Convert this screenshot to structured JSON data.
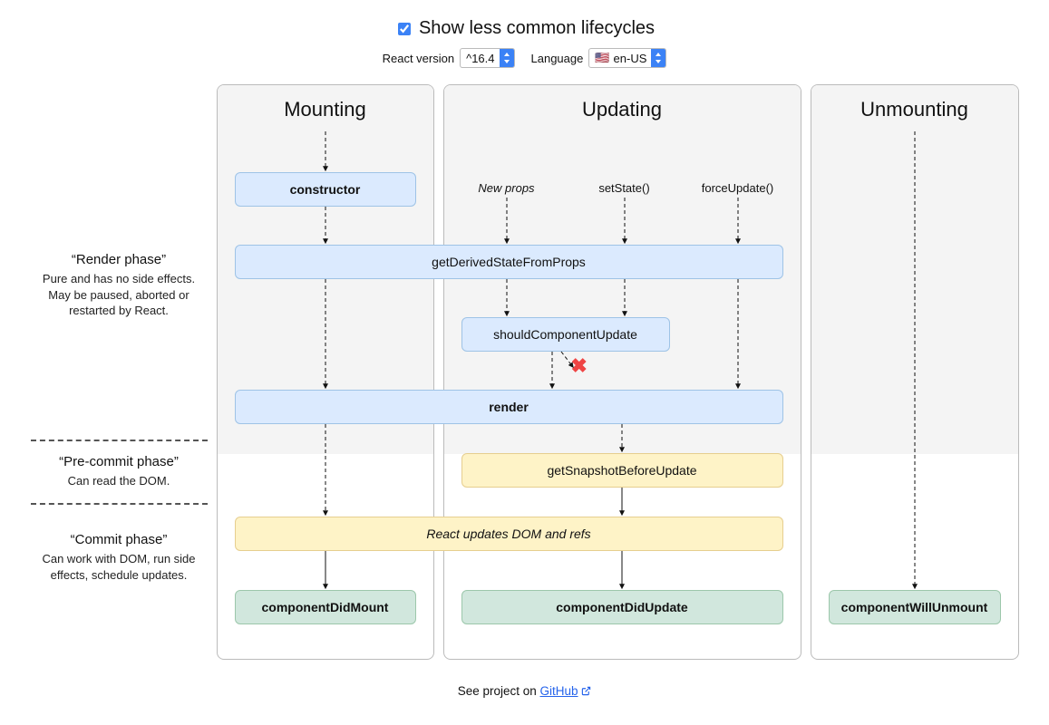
{
  "header": {
    "checkbox_label": "Show less common lifecycles",
    "checkbox_checked": true,
    "react_version_label": "React version",
    "react_version_value": "^16.4",
    "language_label": "Language",
    "language_value": "en-US",
    "language_flag": "🇺🇸"
  },
  "columns": {
    "mounting": {
      "title": "Mounting"
    },
    "updating": {
      "title": "Updating"
    },
    "unmounting": {
      "title": "Unmounting"
    }
  },
  "phases": {
    "render": {
      "title": "“Render phase”",
      "desc": "Pure and has no side effects. May be paused, aborted or restarted by React."
    },
    "precommit": {
      "title": "“Pre-commit phase”",
      "desc": "Can read the DOM."
    },
    "commit": {
      "title": "“Commit phase”",
      "desc": "Can work with DOM, run side effects, schedule updates."
    }
  },
  "triggers": {
    "new_props": "New props",
    "set_state": "setState()",
    "force_update": "forceUpdate()"
  },
  "boxes": {
    "constructor": "constructor",
    "get_derived": "getDerivedStateFromProps",
    "should_update": "shouldComponentUpdate",
    "render": "render",
    "get_snapshot": "getSnapshotBeforeUpdate",
    "react_updates": "React updates DOM and refs",
    "component_did_mount": "componentDidMount",
    "component_did_update": "componentDidUpdate",
    "component_will_unmount": "componentWillUnmount"
  },
  "footer": {
    "prefix": "See project on ",
    "link_text": "GitHub"
  }
}
